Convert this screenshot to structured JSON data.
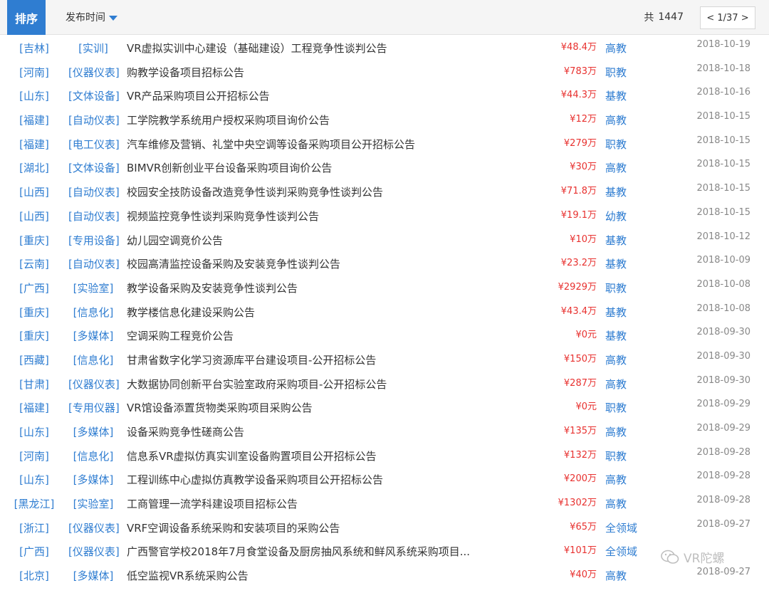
{
  "toolbar": {
    "sort_label": "排序",
    "time_label": "发布时间",
    "total_prefix": "共",
    "total_count": "1447",
    "pager": "< 1/37 >"
  },
  "rows": [
    {
      "region": "[吉林]",
      "category": "[实训]",
      "title": "VR虚拟实训中心建设（基础建设）工程竞争性谈判公告",
      "price": "¥48.4万",
      "level": "高教",
      "date": "2018-10-19"
    },
    {
      "region": "[河南]",
      "category": "[仪器仪表]",
      "title": "购教学设备项目招标公告",
      "price": "¥783万",
      "level": "职教",
      "date": "2018-10-18"
    },
    {
      "region": "[山东]",
      "category": "[文体设备]",
      "title": "VR产品采购项目公开招标公告",
      "price": "¥44.3万",
      "level": "基教",
      "date": "2018-10-16"
    },
    {
      "region": "[福建]",
      "category": "[自动仪表]",
      "title": "工学院教学系统用户授权采购项目询价公告",
      "price": "¥12万",
      "level": "高教",
      "date": "2018-10-15"
    },
    {
      "region": "[福建]",
      "category": "[电工仪表]",
      "title": "汽车维修及营销、礼堂中央空调等设备采购项目公开招标公告",
      "price": "¥279万",
      "level": "职教",
      "date": "2018-10-15"
    },
    {
      "region": "[湖北]",
      "category": "[文体设备]",
      "title": "BIMVR创新创业平台设备采购项目询价公告",
      "price": "¥30万",
      "level": "高教",
      "date": "2018-10-15"
    },
    {
      "region": "[山西]",
      "category": "[自动仪表]",
      "title": "校园安全技防设备改造竞争性谈判采购竞争性谈判公告",
      "price": "¥71.8万",
      "level": "基教",
      "date": "2018-10-15"
    },
    {
      "region": "[山西]",
      "category": "[自动仪表]",
      "title": "视频监控竞争性谈判采购竞争性谈判公告",
      "price": "¥19.1万",
      "level": "幼教",
      "date": "2018-10-15"
    },
    {
      "region": "[重庆]",
      "category": "[专用设备]",
      "title": "幼儿园空调竞价公告",
      "price": "¥10万",
      "level": "基教",
      "date": "2018-10-12"
    },
    {
      "region": "[云南]",
      "category": "[自动仪表]",
      "title": "校园高清监控设备采购及安装竞争性谈判公告",
      "price": "¥23.2万",
      "level": "基教",
      "date": "2018-10-09"
    },
    {
      "region": "[广西]",
      "category": "[实验室]",
      "title": "教学设备采购及安装竞争性谈判公告",
      "price": "¥2929万",
      "level": "职教",
      "date": "2018-10-08"
    },
    {
      "region": "[重庆]",
      "category": "[信息化]",
      "title": "教学楼信息化建设采购公告",
      "price": "¥43.4万",
      "level": "基教",
      "date": "2018-10-08"
    },
    {
      "region": "[重庆]",
      "category": "[多媒体]",
      "title": "空调采购工程竞价公告",
      "price": "¥0元",
      "level": "基教",
      "date": "2018-09-30"
    },
    {
      "region": "[西藏]",
      "category": "[信息化]",
      "title": "甘肃省数字化学习资源库平台建设项目-公开招标公告",
      "price": "¥150万",
      "level": "高教",
      "date": "2018-09-30"
    },
    {
      "region": "[甘肃]",
      "category": "[仪器仪表]",
      "title": "大数据协同创新平台实验室政府采购项目-公开招标公告",
      "price": "¥287万",
      "level": "高教",
      "date": "2018-09-30"
    },
    {
      "region": "[福建]",
      "category": "[专用仪器]",
      "title": "VR馆设备添置货物类采购项目采购公告",
      "price": "¥0元",
      "level": "职教",
      "date": "2018-09-29"
    },
    {
      "region": "[山东]",
      "category": "[多媒体]",
      "title": "设备采购竞争性磋商公告",
      "price": "¥135万",
      "level": "高教",
      "date": "2018-09-29"
    },
    {
      "region": "[河南]",
      "category": "[信息化]",
      "title": "信息系VR虚拟仿真实训室设备购置项目公开招标公告",
      "price": "¥132万",
      "level": "职教",
      "date": "2018-09-28"
    },
    {
      "region": "[山东]",
      "category": "[多媒体]",
      "title": "工程训练中心虚拟仿真教学设备采购项目公开招标公告",
      "price": "¥200万",
      "level": "高教",
      "date": "2018-09-28"
    },
    {
      "region": "[黑龙江]",
      "category": "[实验室]",
      "title": "工商管理一流学科建设项目招标公告",
      "price": "¥1302万",
      "level": "高教",
      "date": "2018-09-28"
    },
    {
      "region": "[浙江]",
      "category": "[仪器仪表]",
      "title": "VRF空调设备系统采购和安装项目的采购公告",
      "price": "¥65万",
      "level": "全领域",
      "date": "2018-09-27"
    },
    {
      "region": "[广西]",
      "category": "[仪器仪表]",
      "title": "广西警官学校2018年7月食堂设备及厨房抽风系统和鲜风系统采购项目...",
      "price": "¥101万",
      "level": "全领域",
      "date": ""
    },
    {
      "region": "[北京]",
      "category": "[多媒体]",
      "title": "低空监视VR系统采购公告",
      "price": "¥40万",
      "level": "高教",
      "date": "2018-09-27"
    }
  ],
  "watermark": {
    "text": "VR陀螺",
    "icon": "wechat-icon"
  }
}
